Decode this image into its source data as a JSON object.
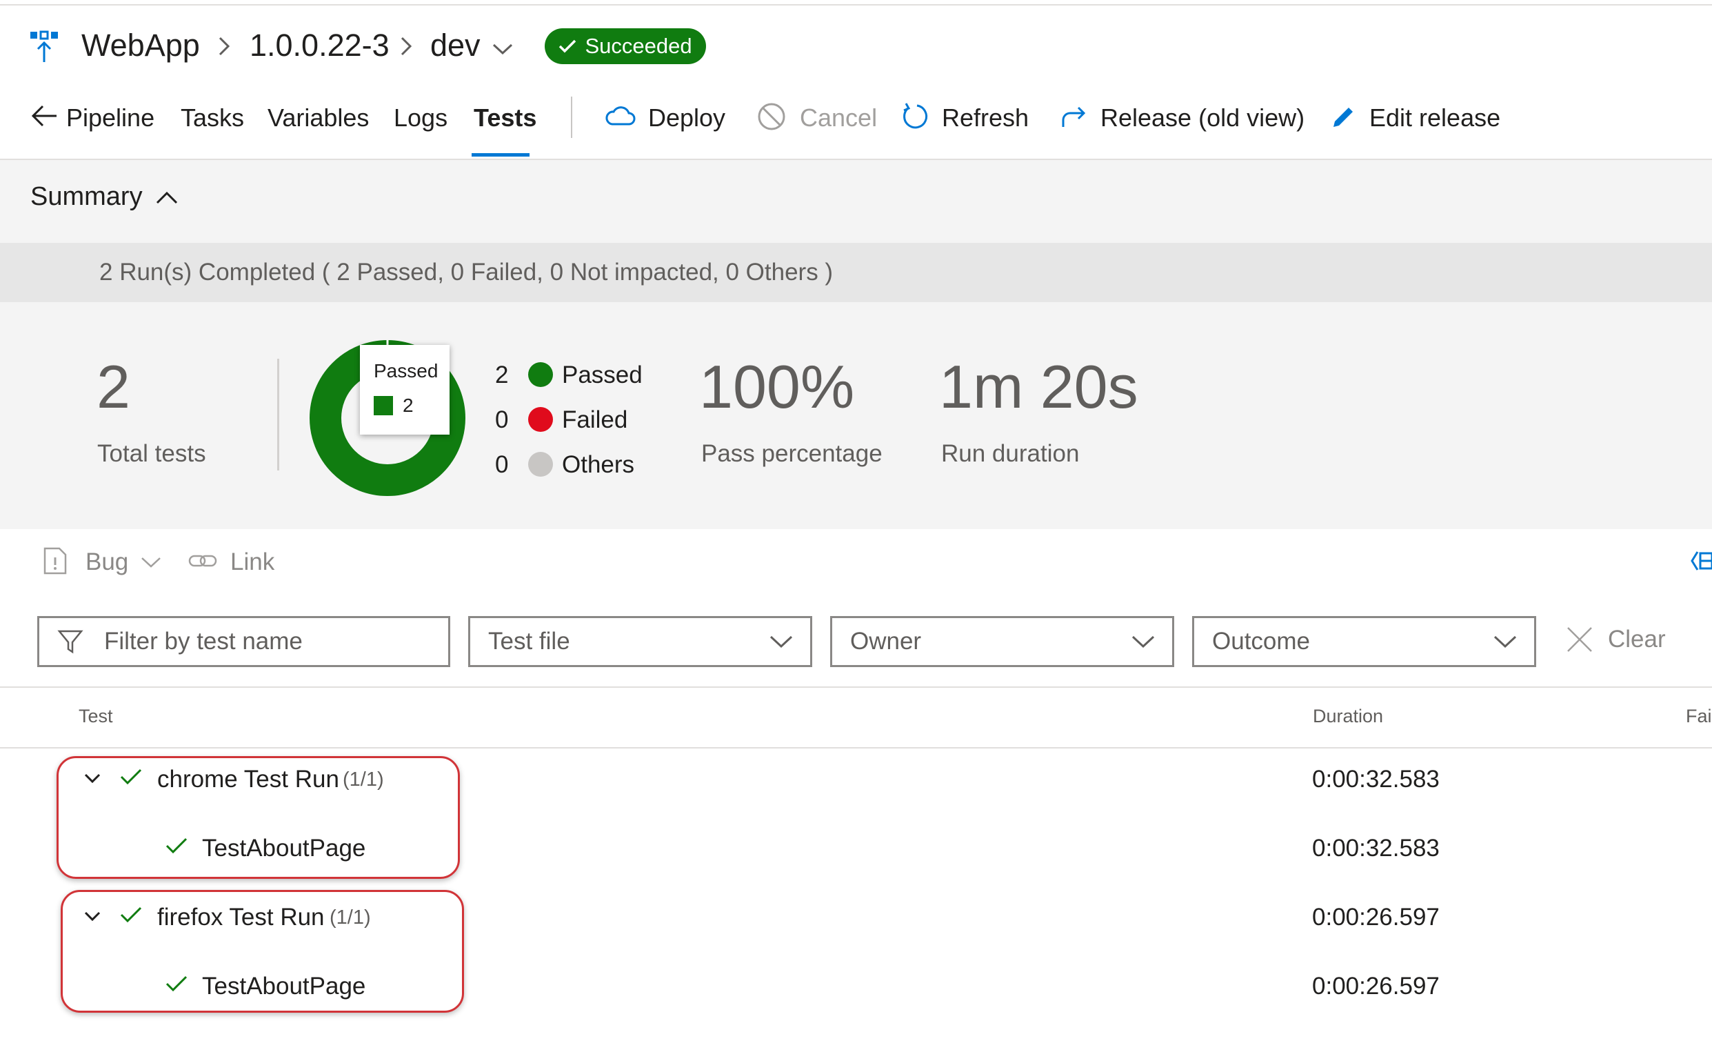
{
  "header": {
    "app_name": "WebApp",
    "release": "1.0.0.22-3",
    "stage": "dev",
    "status_badge": "Succeeded",
    "status_color": "#107c10",
    "accent_color": "#0078d4"
  },
  "tabs": {
    "pipeline": "Pipeline",
    "tasks": "Tasks",
    "variables": "Variables",
    "logs": "Logs",
    "tests": "Tests",
    "active": "Tests"
  },
  "actions": {
    "deploy": "Deploy",
    "cancel": "Cancel",
    "refresh": "Refresh",
    "release_old": "Release (old view)",
    "edit_release": "Edit release"
  },
  "summary": {
    "title": "Summary",
    "runs_text": "2 Run(s) Completed ( 2 Passed, 0 Failed, 0 Not impacted, 0 Others )",
    "total_tests": "2",
    "total_label": "Total tests",
    "chart_tooltip_label": "Passed",
    "chart_tooltip_value": "2",
    "legend": [
      {
        "count": "2",
        "label": "Passed",
        "color": "#107c10"
      },
      {
        "count": "0",
        "label": "Failed",
        "color": "#e00b1c"
      },
      {
        "count": "0",
        "label": "Others",
        "color": "#c8c6c4"
      }
    ],
    "pass_percentage": "100%",
    "pass_label": "Pass percentage",
    "run_duration": "1m 20s",
    "duration_label": "Run duration"
  },
  "chart_data": {
    "type": "pie",
    "categories": [
      "Passed",
      "Failed",
      "Others"
    ],
    "values": [
      2,
      0,
      0
    ],
    "colors": [
      "#107c10",
      "#e00b1c",
      "#c8c6c4"
    ]
  },
  "work_items": {
    "bug": "Bug",
    "link": "Link"
  },
  "filters": {
    "name_placeholder": "Filter by test name",
    "test_file": "Test file",
    "owner": "Owner",
    "outcome": "Outcome",
    "clear": "Clear"
  },
  "grid": {
    "col_test": "Test",
    "col_duration": "Duration",
    "col_fail": "Fail",
    "runs": [
      {
        "name": "chrome Test Run",
        "count": "(1/1)",
        "duration": "0:00:32.583",
        "test": {
          "name": "TestAboutPage",
          "duration": "0:00:32.583"
        }
      },
      {
        "name": "firefox Test Run",
        "count": "(1/1)",
        "duration": "0:00:26.597",
        "test": {
          "name": "TestAboutPage",
          "duration": "0:00:26.597"
        }
      }
    ]
  }
}
